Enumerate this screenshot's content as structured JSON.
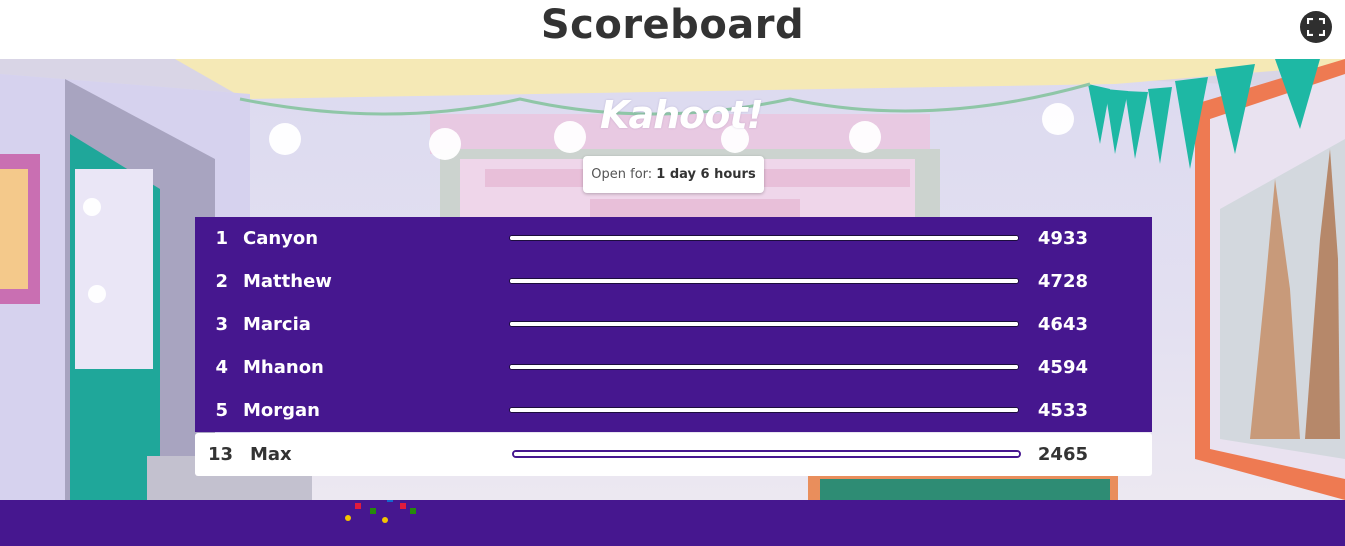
{
  "header": {
    "title": "Scoreboard"
  },
  "icons": {
    "fullscreen": "fullscreen-icon",
    "confetti": "confetti-icon"
  },
  "brand": {
    "logo_text": "Kahoot!",
    "color_primary": "#46178f"
  },
  "status": {
    "open_label": "Open for:",
    "open_value": "1 day 6 hours"
  },
  "leaderboard": [
    {
      "rank": "1",
      "name": "Canyon",
      "score": "4933",
      "progress": 1.0
    },
    {
      "rank": "2",
      "name": "Matthew",
      "score": "4728",
      "progress": 1.0
    },
    {
      "rank": "3",
      "name": "Marcia",
      "score": "4643",
      "progress": 1.0
    },
    {
      "rank": "4",
      "name": "Mhanon",
      "score": "4594",
      "progress": 1.0
    },
    {
      "rank": "5",
      "name": "Morgan",
      "score": "4533",
      "progress": 1.0
    }
  ],
  "current_player": {
    "rank": "13",
    "name": "Max",
    "score": "2465",
    "progress": 1.0
  }
}
